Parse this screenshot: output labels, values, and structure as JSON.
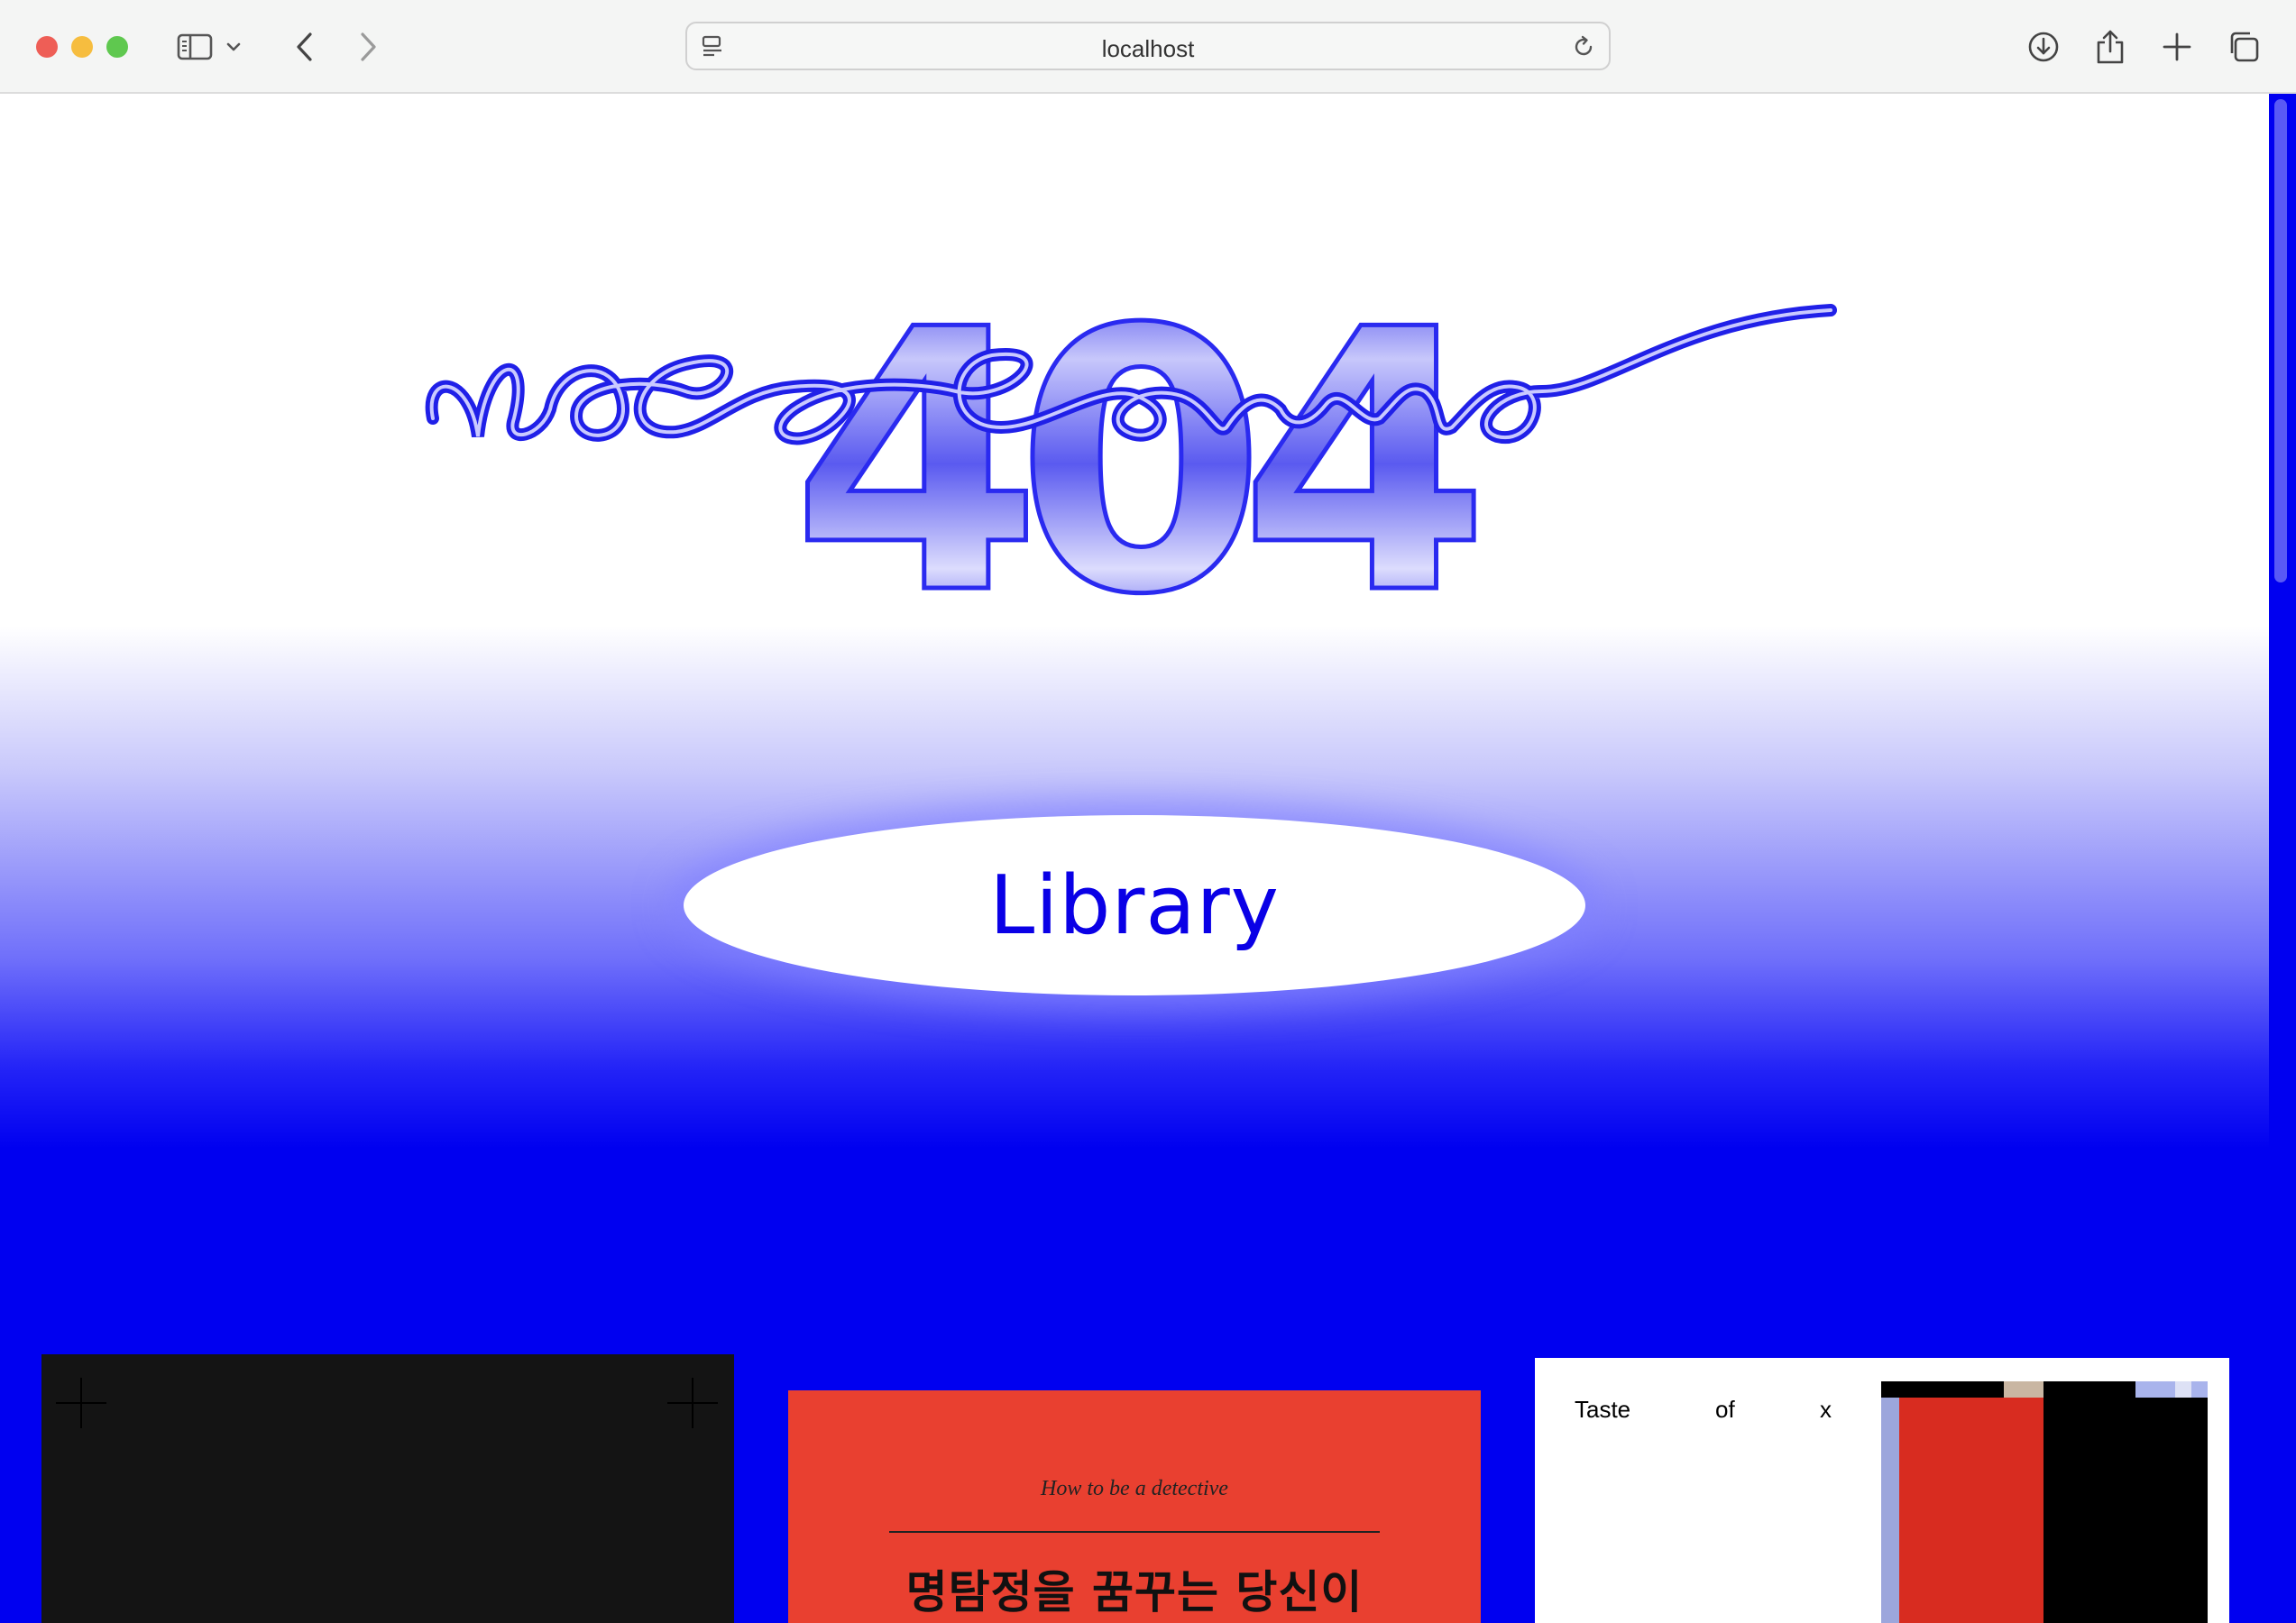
{
  "browser": {
    "url": "localhost",
    "traffic_lights": [
      "#ee5e56",
      "#f6bd3f",
      "#5fc84f"
    ],
    "toolbar_icons": [
      "sidebar-icon",
      "chevron-down-icon",
      "back-icon",
      "forward-icon",
      "site-settings-icon",
      "reload-icon",
      "download-icon",
      "share-icon",
      "new-tab-icon",
      "tab-overview-icon"
    ]
  },
  "hero": {
    "number": "404",
    "script_text": "not found"
  },
  "library_button": {
    "label": "Library"
  },
  "cards": [
    {
      "background": "#141414",
      "decor": [
        "plus-mark",
        "plus-mark"
      ]
    },
    {
      "background": "#e94030",
      "subtitle": "How to be a detective",
      "title": "명탐정을 꿈꾸는 당신이"
    },
    {
      "background": "#ffffff",
      "words": [
        "Taste",
        "of",
        "x"
      ]
    }
  ],
  "colors": {
    "accent_blue": "#0000f0",
    "hero_blue": "#1a1ae8",
    "card_red": "#e94030"
  }
}
